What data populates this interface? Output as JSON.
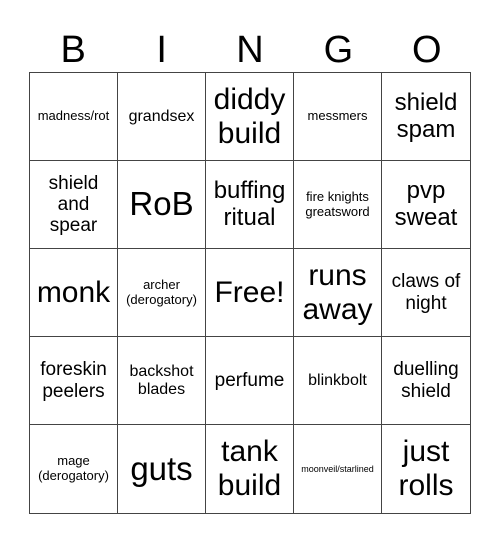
{
  "header": {
    "letters": [
      "B",
      "I",
      "N",
      "G",
      "O"
    ]
  },
  "cells": [
    {
      "text": "madness/rot",
      "size": "s-sm"
    },
    {
      "text": "grandsex",
      "size": "s-md"
    },
    {
      "text": "diddy build",
      "size": "s-xxl"
    },
    {
      "text": "messmers",
      "size": "s-sm"
    },
    {
      "text": "shield spam",
      "size": "s-xl"
    },
    {
      "text": "shield and spear",
      "size": "s-lg"
    },
    {
      "text": "RoB",
      "size": "s-xxxl"
    },
    {
      "text": "buffing ritual",
      "size": "s-xl"
    },
    {
      "text": "fire knights greatsword",
      "size": "s-sm"
    },
    {
      "text": "pvp sweat",
      "size": "s-xl"
    },
    {
      "text": "monk",
      "size": "s-xxl"
    },
    {
      "text": "archer (derogatory)",
      "size": "s-sm"
    },
    {
      "text": "Free!",
      "size": "s-xxl"
    },
    {
      "text": "runs away",
      "size": "s-xxl"
    },
    {
      "text": "claws of night",
      "size": "s-lg"
    },
    {
      "text": "foreskin peelers",
      "size": "s-lg"
    },
    {
      "text": "backshot blades",
      "size": "s-md"
    },
    {
      "text": "perfume",
      "size": "s-lg"
    },
    {
      "text": "blinkbolt",
      "size": "s-md"
    },
    {
      "text": "duelling shield",
      "size": "s-lg"
    },
    {
      "text": "mage (derogatory)",
      "size": "s-sm"
    },
    {
      "text": "guts",
      "size": "s-xxxl"
    },
    {
      "text": "tank build",
      "size": "s-xxl"
    },
    {
      "text": "moonveil/starlined",
      "size": "s-xs"
    },
    {
      "text": "just rolls",
      "size": "s-xxl"
    }
  ]
}
